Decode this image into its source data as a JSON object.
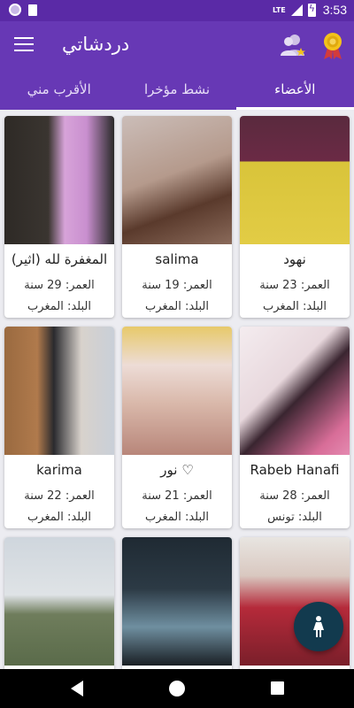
{
  "status_bar": {
    "time": "3:53",
    "network": "LTE"
  },
  "app": {
    "title": "دردشاتي"
  },
  "tabs": [
    {
      "label": "الأعضاء",
      "active": true
    },
    {
      "label": "نشط مؤخرا",
      "active": false
    },
    {
      "label": "الأقرب مني",
      "active": false
    }
  ],
  "members": [
    {
      "name": "نهود",
      "age": "العمر: 23 سنة",
      "country": "البلد: المغرب",
      "photo_colors": [
        "#6b2a45",
        "#d9c43a"
      ]
    },
    {
      "name": "salima",
      "age": "العمر: 19 سنة",
      "country": "البلد: المغرب",
      "photo_colors": [
        "#c8b9b4",
        "#8a6a5a"
      ]
    },
    {
      "name": "المغفرة لله (اثير)",
      "age": "العمر: 29 سنة",
      "country": "البلد: المغرب",
      "photo_colors": [
        "#3a3530",
        "#d7a3d9"
      ]
    },
    {
      "name": "Rabeb Hanafi",
      "age": "العمر: 28 سنة",
      "country": "البلد: تونس",
      "photo_colors": [
        "#f2e7eb",
        "#d86d98"
      ]
    },
    {
      "name": "نور ♡",
      "age": "العمر: 21 سنة",
      "country": "البلد: المغرب",
      "photo_colors": [
        "#e9dbd7",
        "#b8867a"
      ]
    },
    {
      "name": "karima",
      "age": "العمر: 22 سنة",
      "country": "البلد: المغرب",
      "photo_colors": [
        "#b07a4c",
        "#c9cfd8"
      ]
    },
    {
      "name": "",
      "age": "",
      "country": "",
      "photo_colors": [
        "#e8e5e1",
        "#b52a3a"
      ]
    },
    {
      "name": "",
      "age": "",
      "country": "",
      "photo_colors": [
        "#1f2a33",
        "#6f8fa0"
      ]
    },
    {
      "name": "",
      "age": "",
      "country": "",
      "photo_colors": [
        "#cfd6dd",
        "#5a6b4a"
      ]
    }
  ],
  "colors": {
    "primary": "#6738b5",
    "status_bar": "#5a2aa6",
    "fab": "#123a4e",
    "background": "#ececf1"
  },
  "icons": {
    "menu": "menu-icon",
    "users": "users-star-icon",
    "medal": "medal-icon",
    "fab": "person-icon"
  }
}
